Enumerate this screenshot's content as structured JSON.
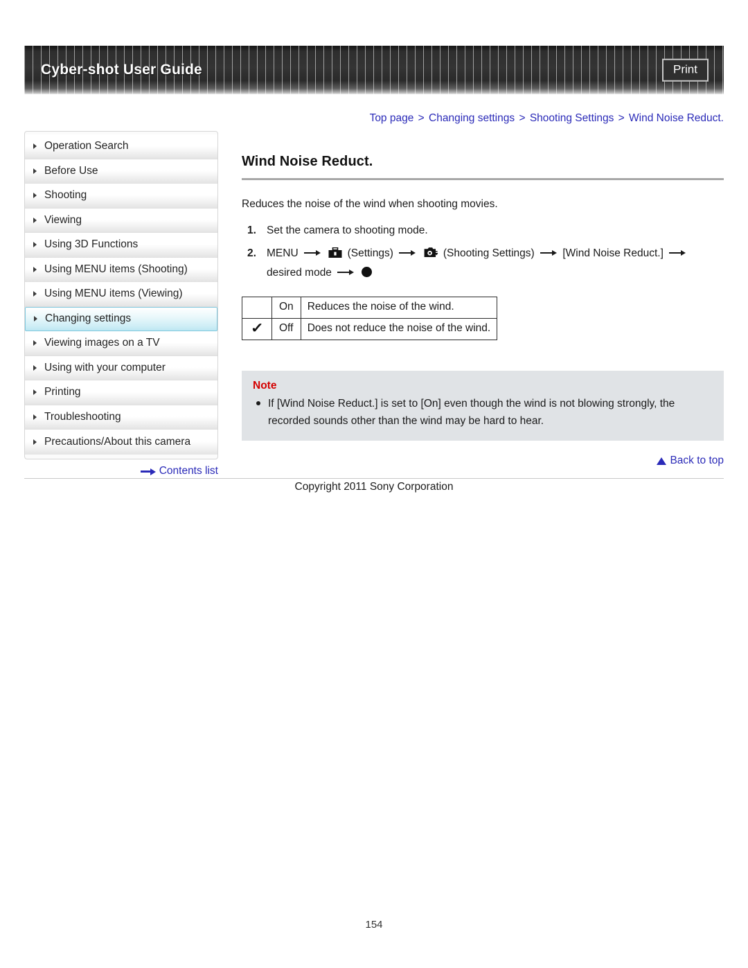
{
  "header": {
    "title": "Cyber-shot User Guide",
    "print_label": "Print"
  },
  "breadcrumb": {
    "items": [
      "Top page",
      "Changing settings",
      "Shooting Settings",
      "Wind Noise Reduct."
    ],
    "separator": ">"
  },
  "sidebar": {
    "items": [
      {
        "label": "Operation Search",
        "selected": false
      },
      {
        "label": "Before Use",
        "selected": false
      },
      {
        "label": "Shooting",
        "selected": false
      },
      {
        "label": "Viewing",
        "selected": false
      },
      {
        "label": "Using 3D Functions",
        "selected": false
      },
      {
        "label": "Using MENU items (Shooting)",
        "selected": false
      },
      {
        "label": "Using MENU items (Viewing)",
        "selected": false
      },
      {
        "label": "Changing settings",
        "selected": true
      },
      {
        "label": "Viewing images on a TV",
        "selected": false
      },
      {
        "label": "Using with your computer",
        "selected": false
      },
      {
        "label": "Printing",
        "selected": false
      },
      {
        "label": "Troubleshooting",
        "selected": false
      },
      {
        "label": "Precautions/About this camera",
        "selected": false
      }
    ],
    "contents_link": "Contents list"
  },
  "main": {
    "title": "Wind Noise Reduct.",
    "intro": "Reduces the noise of the wind when shooting movies.",
    "step1_num": "1.",
    "step1_text": "Set the camera to shooting mode.",
    "step2_num": "2.",
    "step2_menu": "MENU",
    "step2_settings_label": "(Settings)",
    "step2_shooting_label": "(Shooting Settings)",
    "step2_item": "[Wind Noise Reduct.]",
    "step2_desired": "desired",
    "step2_mode": "mode",
    "table": {
      "rows": [
        {
          "mark": "",
          "name": "On",
          "description": "Reduces the noise of the wind."
        },
        {
          "mark": "✓",
          "name": "Off",
          "description": "Does not reduce the noise of the wind."
        }
      ]
    },
    "note": {
      "heading": "Note",
      "items": [
        "If [Wind Noise Reduct.] is set to [On] even though the wind is not blowing strongly, the recorded sounds other than the wind may be hard to hear."
      ]
    },
    "back_to_top": "Back to top"
  },
  "footer": {
    "copyright": "Copyright 2011 Sony Corporation",
    "page_number": "154"
  },
  "colors": {
    "link": "#2a2ab8",
    "note_heading": "#d40000",
    "selected_nav": "#bde7f2",
    "header_bg": "#2e2e2e"
  }
}
